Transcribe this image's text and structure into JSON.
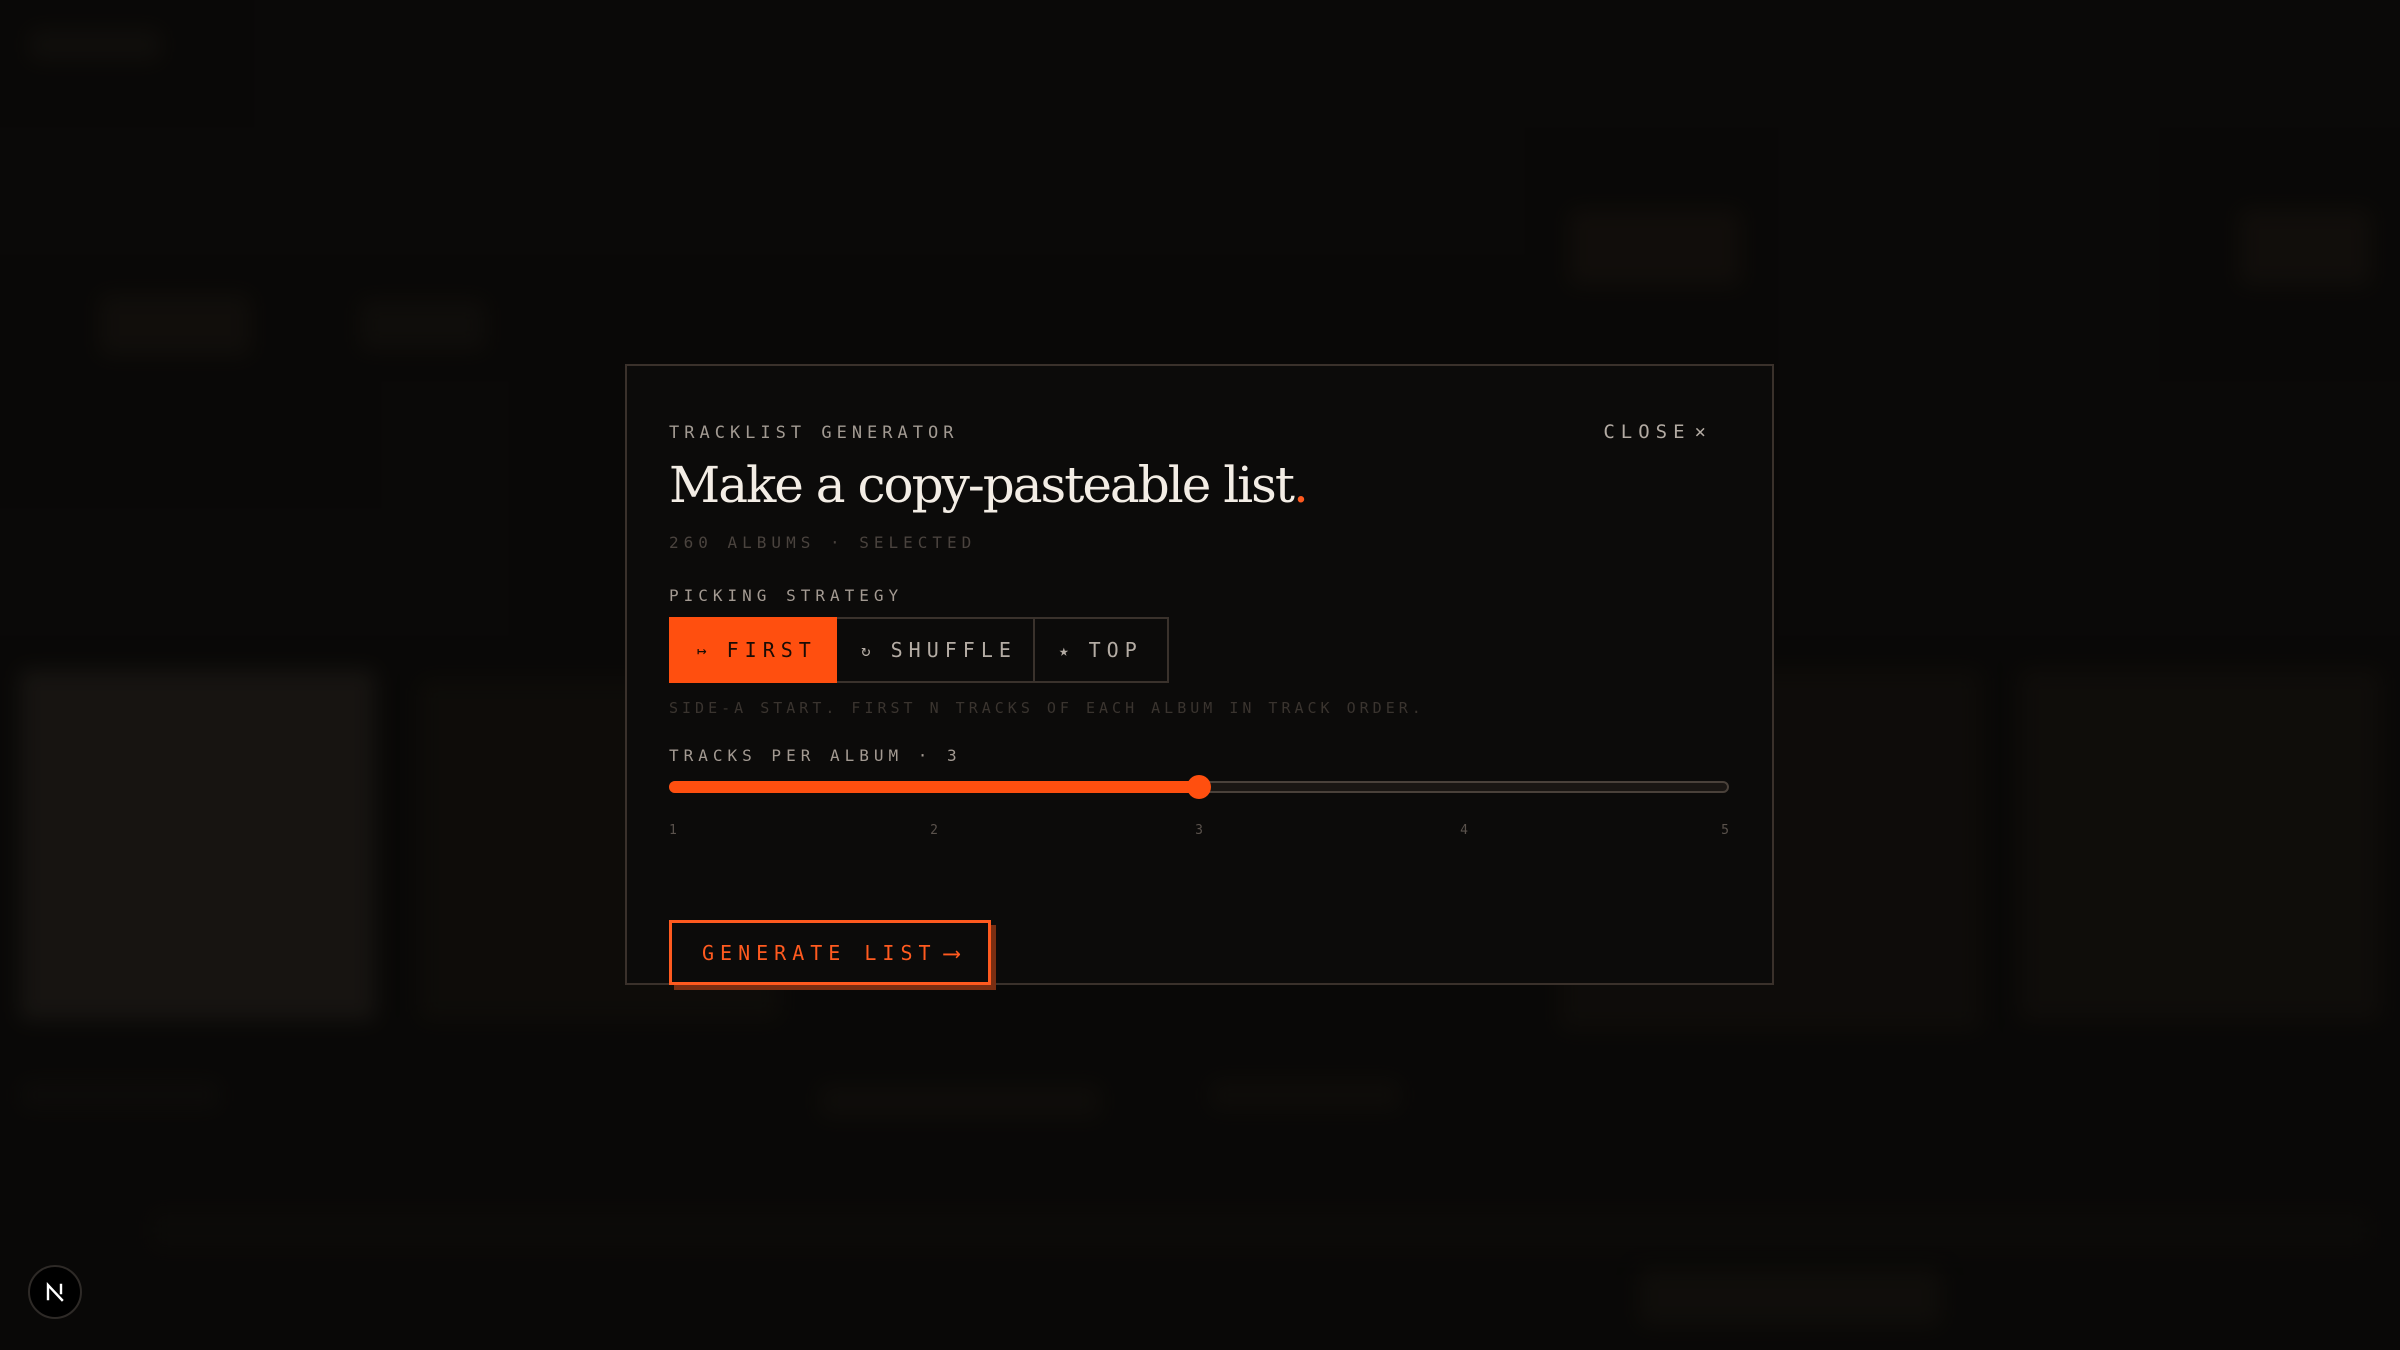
{
  "modal": {
    "kicker": "TRACKLIST GENERATOR",
    "close_label": "CLOSE",
    "close_icon": "×",
    "headline": "Make a copy-pasteable list",
    "headline_dot": ".",
    "selection_count": "260 ALBUMS · SELECTED",
    "strategy_label": "PICKING STRATEGY",
    "strategies": [
      {
        "icon": "↦",
        "icon_name": "arrow-from-bar-icon",
        "label": "FIRST",
        "active": true
      },
      {
        "icon": "↻",
        "icon_name": "shuffle-icon",
        "label": "SHUFFLE",
        "active": false
      },
      {
        "icon": "★",
        "icon_name": "star-icon",
        "label": "TOP",
        "active": false
      }
    ],
    "strategy_hint": "SIDE-A START. FIRST N TRACKS OF EACH ALBUM IN TRACK ORDER.",
    "tracks_label": "TRACKS PER ALBUM · 3",
    "tracks_per_album": {
      "value": 3,
      "min": 1,
      "max": 5
    },
    "tick_labels": [
      "1",
      "2",
      "3",
      "4",
      "5"
    ],
    "generate_label": "GENERATE LIST",
    "generate_arrow": "⟶"
  },
  "badge": {
    "icon_name": "nextjs-logo-icon"
  },
  "colors": {
    "accent": "#ff4f0f",
    "background": "#0d0b0a",
    "text_primary": "#f3ede5",
    "text_muted": "#a39a92"
  }
}
